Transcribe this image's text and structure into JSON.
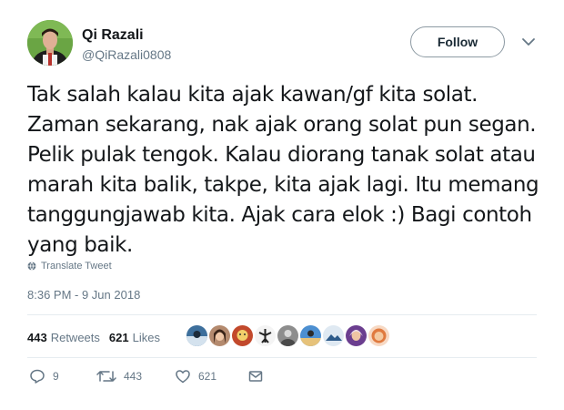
{
  "profile": {
    "name": "Qi Razali",
    "handle": "@QiRazali0808",
    "avatar_icon": "avatar-photo-icon"
  },
  "header": {
    "follow_label": "Follow",
    "menu_icon": "chevron-down-icon"
  },
  "tweet": {
    "text": "Tak salah kalau kita ajak kawan/gf kita solat. Zaman sekarang, nak ajak orang solat pun segan. Pelik pulak tengok. Kalau diorang tanak solat atau marah kita balik, takpe, kita ajak lagi. Itu memang tanggungjawab kita. Ajak cara elok :) Bagi contoh yang baik.",
    "translate_label": "Translate Tweet",
    "timestamp": "8:36 PM - 9 Jun 2018"
  },
  "stats": {
    "retweets_count": "443",
    "retweets_label": "Retweets",
    "likes_count": "621",
    "likes_label": "Likes",
    "liker_avatar_count": 9
  },
  "actions": {
    "reply_count": "9",
    "retweet_count": "443",
    "like_count": "621"
  },
  "colors": {
    "text": "#14171a",
    "muted": "#657786",
    "divider": "#e6ecf0",
    "follow_border": "#8d9aa3"
  }
}
